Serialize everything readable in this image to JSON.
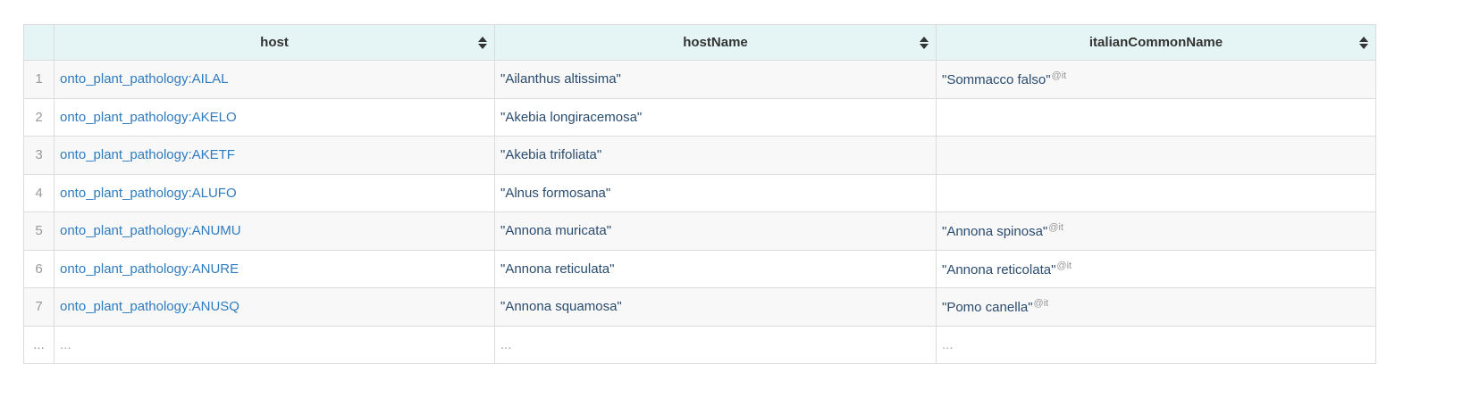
{
  "columns": [
    {
      "label": "host"
    },
    {
      "label": "hostName"
    },
    {
      "label": "italianCommonName"
    }
  ],
  "rows": [
    {
      "index": "1",
      "host": "onto_plant_pathology:AILAL",
      "hostName": "\"Ailanthus altissima\"",
      "italianCommonName": "\"Sommacco falso\"",
      "lang": "@it"
    },
    {
      "index": "2",
      "host": "onto_plant_pathology:AKELO",
      "hostName": "\"Akebia longiracemosa\"",
      "italianCommonName": "",
      "lang": ""
    },
    {
      "index": "3",
      "host": "onto_plant_pathology:AKETF",
      "hostName": "\"Akebia trifoliata\"",
      "italianCommonName": "",
      "lang": ""
    },
    {
      "index": "4",
      "host": "onto_plant_pathology:ALUFO",
      "hostName": "\"Alnus formosana\"",
      "italianCommonName": "",
      "lang": ""
    },
    {
      "index": "5",
      "host": "onto_plant_pathology:ANUMU",
      "hostName": "\"Annona muricata\"",
      "italianCommonName": "\"Annona spinosa\"",
      "lang": "@it"
    },
    {
      "index": "6",
      "host": "onto_plant_pathology:ANURE",
      "hostName": "\"Annona reticulata\"",
      "italianCommonName": "\"Annona reticolata\"",
      "lang": "@it"
    },
    {
      "index": "7",
      "host": "onto_plant_pathology:ANUSQ",
      "hostName": "\"Annona squamosa\"",
      "italianCommonName": "\"Pomo canella\"",
      "lang": "@it"
    }
  ],
  "ellipsis": {
    "index": "...",
    "host": "...",
    "hostName": "...",
    "italianCommonName": "..."
  }
}
